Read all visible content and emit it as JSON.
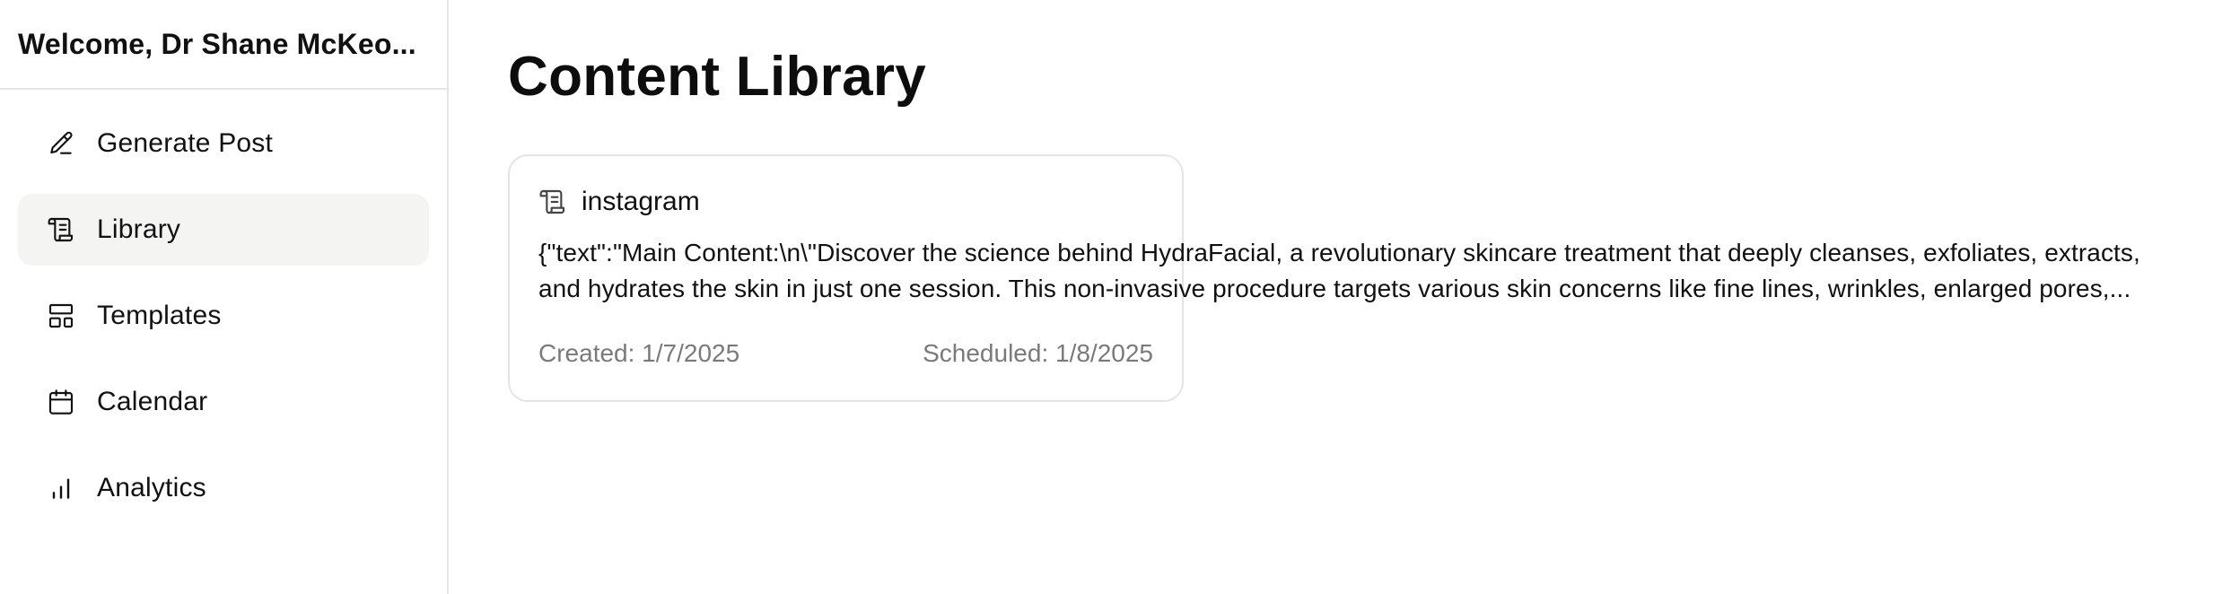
{
  "sidebar": {
    "welcome": "Welcome, Dr Shane McKeo...",
    "items": [
      {
        "label": "Generate Post",
        "icon": "pencil-icon",
        "active": false
      },
      {
        "label": "Library",
        "icon": "scroll-icon",
        "active": true
      },
      {
        "label": "Templates",
        "icon": "layout-icon",
        "active": false
      },
      {
        "label": "Calendar",
        "icon": "calendar-icon",
        "active": false
      },
      {
        "label": "Analytics",
        "icon": "bar-chart-icon",
        "active": false
      }
    ]
  },
  "main": {
    "title": "Content Library",
    "cards": [
      {
        "platform": "instagram",
        "platform_icon": "scroll-icon",
        "text_line1": "{\"text\":\"Main Content:\\n\\\"Discover the science behind HydraFacial, a revolutionary skincare treatment that deeply cleanses, exfoliates, extracts,",
        "text_line2": "and hydrates the skin in just one session. This non-invasive procedure targets various skin concerns like fine lines, wrinkles, enlarged pores,...",
        "created": "Created: 1/7/2025",
        "scheduled": "Scheduled: 1/8/2025"
      }
    ]
  },
  "colors": {
    "active_bg": "#f4f4f3",
    "border": "#e6e6e6",
    "muted_text": "#7a7a7a"
  }
}
